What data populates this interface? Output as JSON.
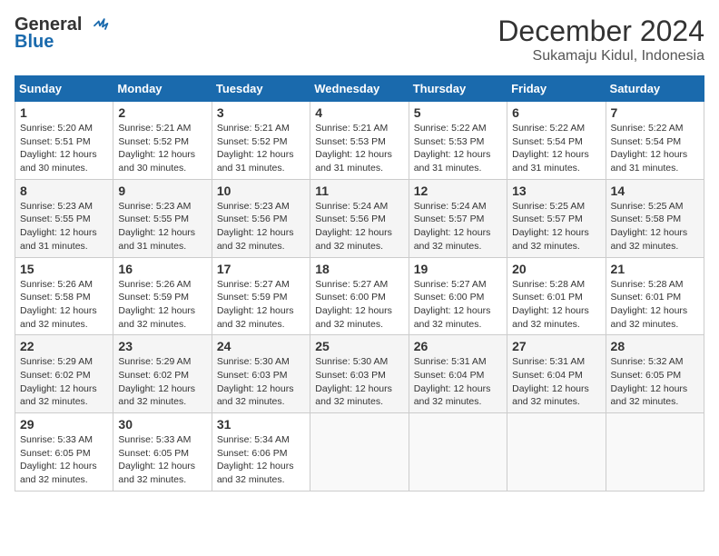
{
  "logo": {
    "line1": "General",
    "line2": "Blue"
  },
  "title": "December 2024",
  "subtitle": "Sukamaju Kidul, Indonesia",
  "days_header": [
    "Sunday",
    "Monday",
    "Tuesday",
    "Wednesday",
    "Thursday",
    "Friday",
    "Saturday"
  ],
  "weeks": [
    [
      {
        "day": "1",
        "info": "Sunrise: 5:20 AM\nSunset: 5:51 PM\nDaylight: 12 hours\nand 30 minutes."
      },
      {
        "day": "2",
        "info": "Sunrise: 5:21 AM\nSunset: 5:52 PM\nDaylight: 12 hours\nand 30 minutes."
      },
      {
        "day": "3",
        "info": "Sunrise: 5:21 AM\nSunset: 5:52 PM\nDaylight: 12 hours\nand 31 minutes."
      },
      {
        "day": "4",
        "info": "Sunrise: 5:21 AM\nSunset: 5:53 PM\nDaylight: 12 hours\nand 31 minutes."
      },
      {
        "day": "5",
        "info": "Sunrise: 5:22 AM\nSunset: 5:53 PM\nDaylight: 12 hours\nand 31 minutes."
      },
      {
        "day": "6",
        "info": "Sunrise: 5:22 AM\nSunset: 5:54 PM\nDaylight: 12 hours\nand 31 minutes."
      },
      {
        "day": "7",
        "info": "Sunrise: 5:22 AM\nSunset: 5:54 PM\nDaylight: 12 hours\nand 31 minutes."
      }
    ],
    [
      {
        "day": "8",
        "info": "Sunrise: 5:23 AM\nSunset: 5:55 PM\nDaylight: 12 hours\nand 31 minutes."
      },
      {
        "day": "9",
        "info": "Sunrise: 5:23 AM\nSunset: 5:55 PM\nDaylight: 12 hours\nand 31 minutes."
      },
      {
        "day": "10",
        "info": "Sunrise: 5:23 AM\nSunset: 5:56 PM\nDaylight: 12 hours\nand 32 minutes."
      },
      {
        "day": "11",
        "info": "Sunrise: 5:24 AM\nSunset: 5:56 PM\nDaylight: 12 hours\nand 32 minutes."
      },
      {
        "day": "12",
        "info": "Sunrise: 5:24 AM\nSunset: 5:57 PM\nDaylight: 12 hours\nand 32 minutes."
      },
      {
        "day": "13",
        "info": "Sunrise: 5:25 AM\nSunset: 5:57 PM\nDaylight: 12 hours\nand 32 minutes."
      },
      {
        "day": "14",
        "info": "Sunrise: 5:25 AM\nSunset: 5:58 PM\nDaylight: 12 hours\nand 32 minutes."
      }
    ],
    [
      {
        "day": "15",
        "info": "Sunrise: 5:26 AM\nSunset: 5:58 PM\nDaylight: 12 hours\nand 32 minutes."
      },
      {
        "day": "16",
        "info": "Sunrise: 5:26 AM\nSunset: 5:59 PM\nDaylight: 12 hours\nand 32 minutes."
      },
      {
        "day": "17",
        "info": "Sunrise: 5:27 AM\nSunset: 5:59 PM\nDaylight: 12 hours\nand 32 minutes."
      },
      {
        "day": "18",
        "info": "Sunrise: 5:27 AM\nSunset: 6:00 PM\nDaylight: 12 hours\nand 32 minutes."
      },
      {
        "day": "19",
        "info": "Sunrise: 5:27 AM\nSunset: 6:00 PM\nDaylight: 12 hours\nand 32 minutes."
      },
      {
        "day": "20",
        "info": "Sunrise: 5:28 AM\nSunset: 6:01 PM\nDaylight: 12 hours\nand 32 minutes."
      },
      {
        "day": "21",
        "info": "Sunrise: 5:28 AM\nSunset: 6:01 PM\nDaylight: 12 hours\nand 32 minutes."
      }
    ],
    [
      {
        "day": "22",
        "info": "Sunrise: 5:29 AM\nSunset: 6:02 PM\nDaylight: 12 hours\nand 32 minutes."
      },
      {
        "day": "23",
        "info": "Sunrise: 5:29 AM\nSunset: 6:02 PM\nDaylight: 12 hours\nand 32 minutes."
      },
      {
        "day": "24",
        "info": "Sunrise: 5:30 AM\nSunset: 6:03 PM\nDaylight: 12 hours\nand 32 minutes."
      },
      {
        "day": "25",
        "info": "Sunrise: 5:30 AM\nSunset: 6:03 PM\nDaylight: 12 hours\nand 32 minutes."
      },
      {
        "day": "26",
        "info": "Sunrise: 5:31 AM\nSunset: 6:04 PM\nDaylight: 12 hours\nand 32 minutes."
      },
      {
        "day": "27",
        "info": "Sunrise: 5:31 AM\nSunset: 6:04 PM\nDaylight: 12 hours\nand 32 minutes."
      },
      {
        "day": "28",
        "info": "Sunrise: 5:32 AM\nSunset: 6:05 PM\nDaylight: 12 hours\nand 32 minutes."
      }
    ],
    [
      {
        "day": "29",
        "info": "Sunrise: 5:33 AM\nSunset: 6:05 PM\nDaylight: 12 hours\nand 32 minutes."
      },
      {
        "day": "30",
        "info": "Sunrise: 5:33 AM\nSunset: 6:05 PM\nDaylight: 12 hours\nand 32 minutes."
      },
      {
        "day": "31",
        "info": "Sunrise: 5:34 AM\nSunset: 6:06 PM\nDaylight: 12 hours\nand 32 minutes."
      },
      {
        "day": "",
        "info": ""
      },
      {
        "day": "",
        "info": ""
      },
      {
        "day": "",
        "info": ""
      },
      {
        "day": "",
        "info": ""
      }
    ]
  ]
}
